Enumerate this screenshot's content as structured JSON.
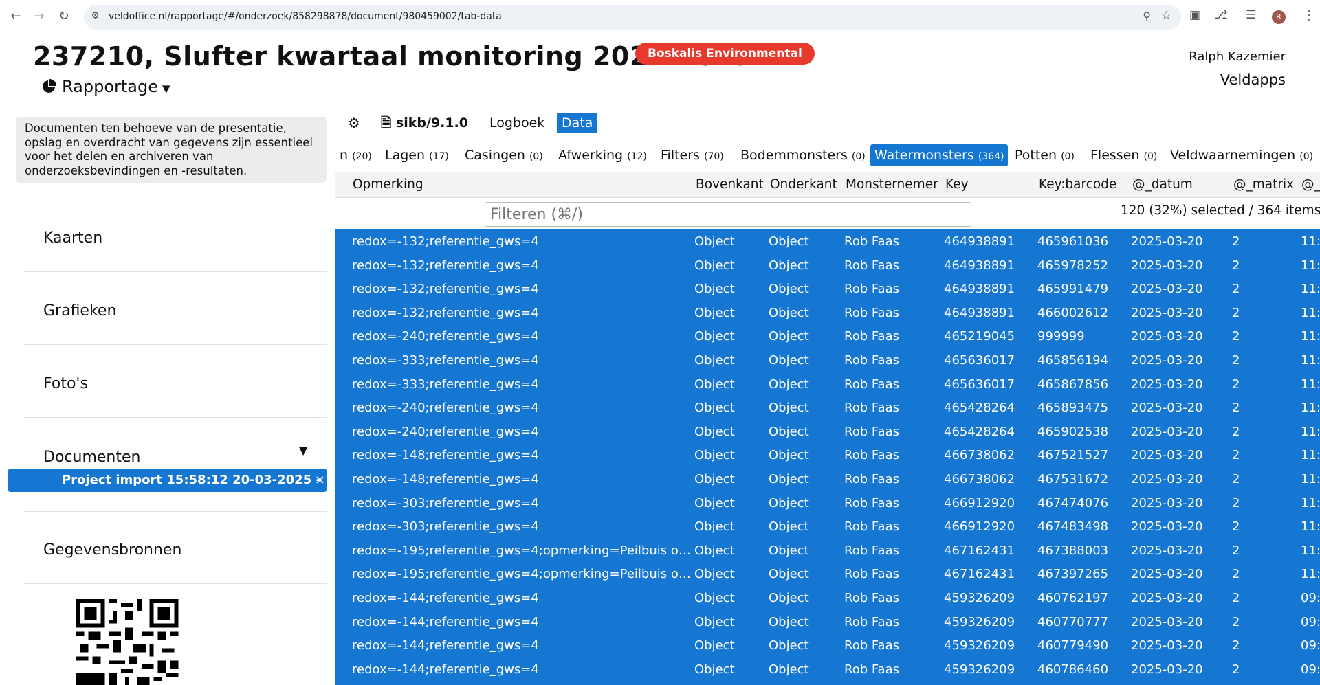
{
  "browser": {
    "url": "veldoffice.nl/rapportage/#/onderzoek/858298878/document/980459002/tab-data",
    "profile_initial": "R"
  },
  "header": {
    "title": "237210, Slufter kwartaal monitoring 2024-2027",
    "company": "Boskalis Environmental",
    "module": "Rapportage",
    "user": "Ralph Kazemier",
    "org": "Veldapps"
  },
  "colors": {
    "accent": "#1677d2",
    "badge": "#e8392d"
  },
  "sidebar": {
    "info": "Documenten ten behoeve van de presentatie, opslag en overdracht van gegevens zijn essentieel voor het delen en archiveren van onderzoeksbevindingen en -resultaten.",
    "items": [
      {
        "label": "Kaarten"
      },
      {
        "label": "Grafieken"
      },
      {
        "label": "Foto's"
      },
      {
        "label": "Documenten"
      },
      {
        "label": "Gegevensbronnen"
      }
    ],
    "selected_document": "Project import 15:58:12 20-03-2025 - "
  },
  "toolbar": {
    "format": "sikb/9.1.0",
    "logboek": "Logboek",
    "data": "Data"
  },
  "tabs": [
    {
      "label": "n",
      "count": "(20)"
    },
    {
      "label": "Lagen",
      "count": "(17)"
    },
    {
      "label": "Casingen",
      "count": "(0)"
    },
    {
      "label": "Afwerking",
      "count": "(12)"
    },
    {
      "label": "Filters",
      "count": "(70)"
    },
    {
      "label": "Bodemmonsters",
      "count": "(0)"
    },
    {
      "label": "Watermonsters",
      "count": "(364)"
    },
    {
      "label": "Potten",
      "count": "(0)"
    },
    {
      "label": "Flessen",
      "count": "(0)"
    },
    {
      "label": "Veldwaarnemingen",
      "count": "(0)"
    }
  ],
  "columns": [
    "Opmerking",
    "Bovenkant",
    "Onderkant",
    "Monsternemer",
    "Key",
    "Key:barcode",
    "@_datum",
    "@_matrix",
    "@_t"
  ],
  "filter": {
    "placeholder": "Filteren (⌘/)"
  },
  "selection_summary": "120 (32%) selected / 364 items",
  "rows": [
    {
      "opmerking": "redox=-132;referentie_gws=4",
      "bovenkant": "Object",
      "onderkant": "Object",
      "monsternemer": "Rob Faas",
      "key": "464938891",
      "barcode": "465961036",
      "datum": "2025-03-20",
      "matrix": "2",
      "tijd": "11:"
    },
    {
      "opmerking": "redox=-132;referentie_gws=4",
      "bovenkant": "Object",
      "onderkant": "Object",
      "monsternemer": "Rob Faas",
      "key": "464938891",
      "barcode": "465978252",
      "datum": "2025-03-20",
      "matrix": "2",
      "tijd": "11:"
    },
    {
      "opmerking": "redox=-132;referentie_gws=4",
      "bovenkant": "Object",
      "onderkant": "Object",
      "monsternemer": "Rob Faas",
      "key": "464938891",
      "barcode": "465991479",
      "datum": "2025-03-20",
      "matrix": "2",
      "tijd": "11:"
    },
    {
      "opmerking": "redox=-132;referentie_gws=4",
      "bovenkant": "Object",
      "onderkant": "Object",
      "monsternemer": "Rob Faas",
      "key": "464938891",
      "barcode": "466002612",
      "datum": "2025-03-20",
      "matrix": "2",
      "tijd": "11:"
    },
    {
      "opmerking": "redox=-240;referentie_gws=4",
      "bovenkant": "Object",
      "onderkant": "Object",
      "monsternemer": "Rob Faas",
      "key": "465219045",
      "barcode": "999999",
      "datum": "2025-03-20",
      "matrix": "2",
      "tijd": "11:"
    },
    {
      "opmerking": "redox=-333;referentie_gws=4",
      "bovenkant": "Object",
      "onderkant": "Object",
      "monsternemer": "Rob Faas",
      "key": "465636017",
      "barcode": "465856194",
      "datum": "2025-03-20",
      "matrix": "2",
      "tijd": "11:"
    },
    {
      "opmerking": "redox=-333;referentie_gws=4",
      "bovenkant": "Object",
      "onderkant": "Object",
      "monsternemer": "Rob Faas",
      "key": "465636017",
      "barcode": "465867856",
      "datum": "2025-03-20",
      "matrix": "2",
      "tijd": "11:"
    },
    {
      "opmerking": "redox=-240;referentie_gws=4",
      "bovenkant": "Object",
      "onderkant": "Object",
      "monsternemer": "Rob Faas",
      "key": "465428264",
      "barcode": "465893475",
      "datum": "2025-03-20",
      "matrix": "2",
      "tijd": "11:"
    },
    {
      "opmerking": "redox=-240;referentie_gws=4",
      "bovenkant": "Object",
      "onderkant": "Object",
      "monsternemer": "Rob Faas",
      "key": "465428264",
      "barcode": "465902538",
      "datum": "2025-03-20",
      "matrix": "2",
      "tijd": "11:"
    },
    {
      "opmerking": "redox=-148;referentie_gws=4",
      "bovenkant": "Object",
      "onderkant": "Object",
      "monsternemer": "Rob Faas",
      "key": "466738062",
      "barcode": "467521527",
      "datum": "2025-03-20",
      "matrix": "2",
      "tijd": "11:"
    },
    {
      "opmerking": "redox=-148;referentie_gws=4",
      "bovenkant": "Object",
      "onderkant": "Object",
      "monsternemer": "Rob Faas",
      "key": "466738062",
      "barcode": "467531672",
      "datum": "2025-03-20",
      "matrix": "2",
      "tijd": "11:"
    },
    {
      "opmerking": "redox=-303;referentie_gws=4",
      "bovenkant": "Object",
      "onderkant": "Object",
      "monsternemer": "Rob Faas",
      "key": "466912920",
      "barcode": "467474076",
      "datum": "2025-03-20",
      "matrix": "2",
      "tijd": "11:"
    },
    {
      "opmerking": "redox=-303;referentie_gws=4",
      "bovenkant": "Object",
      "onderkant": "Object",
      "monsternemer": "Rob Faas",
      "key": "466912920",
      "barcode": "467483498",
      "datum": "2025-03-20",
      "matrix": "2",
      "tijd": "11:"
    },
    {
      "opmerking": "redox=-195;referentie_gws=4;opmerking=Peilbuis o…",
      "bovenkant": "Object",
      "onderkant": "Object",
      "monsternemer": "Rob Faas",
      "key": "467162431",
      "barcode": "467388003",
      "datum": "2025-03-20",
      "matrix": "2",
      "tijd": "11:"
    },
    {
      "opmerking": "redox=-195;referentie_gws=4;opmerking=Peilbuis o…",
      "bovenkant": "Object",
      "onderkant": "Object",
      "monsternemer": "Rob Faas",
      "key": "467162431",
      "barcode": "467397265",
      "datum": "2025-03-20",
      "matrix": "2",
      "tijd": "11:"
    },
    {
      "opmerking": "redox=-144;referentie_gws=4",
      "bovenkant": "Object",
      "onderkant": "Object",
      "monsternemer": "Rob Faas",
      "key": "459326209",
      "barcode": "460762197",
      "datum": "2025-03-20",
      "matrix": "2",
      "tijd": "09:"
    },
    {
      "opmerking": "redox=-144;referentie_gws=4",
      "bovenkant": "Object",
      "onderkant": "Object",
      "monsternemer": "Rob Faas",
      "key": "459326209",
      "barcode": "460770777",
      "datum": "2025-03-20",
      "matrix": "2",
      "tijd": "09:"
    },
    {
      "opmerking": "redox=-144;referentie_gws=4",
      "bovenkant": "Object",
      "onderkant": "Object",
      "monsternemer": "Rob Faas",
      "key": "459326209",
      "barcode": "460779490",
      "datum": "2025-03-20",
      "matrix": "2",
      "tijd": "09:"
    },
    {
      "opmerking": "redox=-144;referentie_gws=4",
      "bovenkant": "Object",
      "onderkant": "Object",
      "monsternemer": "Rob Faas",
      "key": "459326209",
      "barcode": "460786460",
      "datum": "2025-03-20",
      "matrix": "2",
      "tijd": "09:"
    }
  ]
}
